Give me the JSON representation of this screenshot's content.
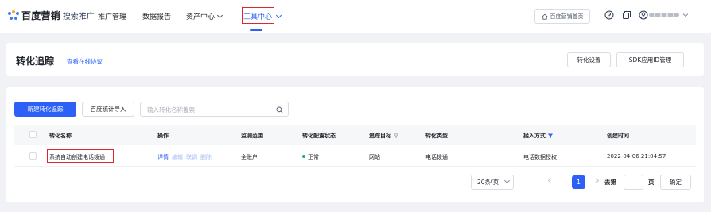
{
  "topnav": {
    "brand": "百度营销",
    "brand_sub": "搜索推广",
    "items": [
      {
        "label": "推广管理"
      },
      {
        "label": "数据报告"
      },
      {
        "label": "资产中心"
      },
      {
        "label": "工具中心"
      }
    ],
    "home_label": "百度营销首页",
    "icons": [
      "help-icon",
      "copy-icon",
      "user-icon",
      "chevron-down-icon"
    ],
    "accent_color": "#2d60f6"
  },
  "page": {
    "title": "转化追踪",
    "protocol_link": "查看在线协议",
    "settings_button": "转化设置",
    "sdk_button": "SDK应用ID管理"
  },
  "toolbar": {
    "new_button": "新建转化追踪",
    "import_button": "百度统计导入",
    "search_placeholder": "输入转化名称搜索"
  },
  "table": {
    "columns": [
      "转化名称",
      "操作",
      "监测范围",
      "转化配置状态",
      "追踪目标",
      "转化类型",
      "接入方式",
      "创建时间"
    ],
    "rows": [
      {
        "name": "系统自动创建电话拨通",
        "actions": [
          "详情",
          "编辑",
          "联调",
          "删除"
        ],
        "scope": "全账户",
        "status": "正常",
        "target": "网站",
        "type": "电话拨通",
        "access": "电话数据授权",
        "created": "2022-04-06 21:04:57"
      }
    ]
  },
  "pagination": {
    "page_size": "20条/页",
    "current_page": "1",
    "goto_prefix": "去第",
    "goto_suffix": "页",
    "confirm": "确定"
  }
}
